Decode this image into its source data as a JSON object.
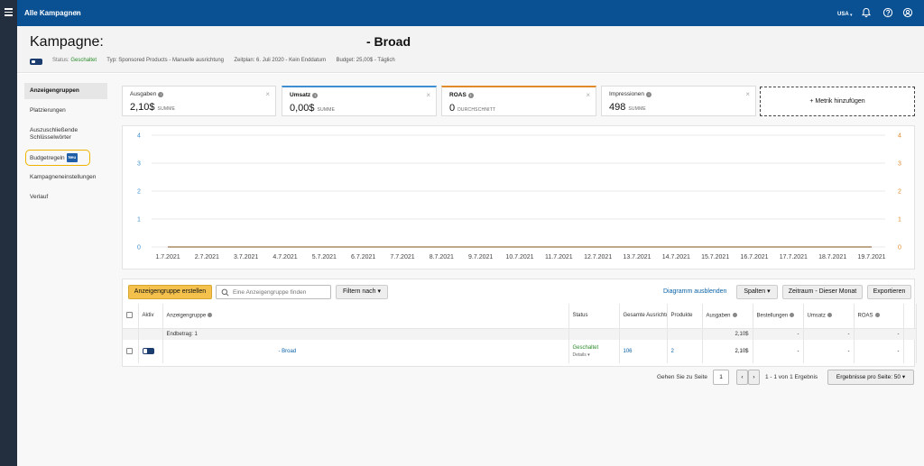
{
  "topbar": {
    "breadcrumb": "Alle Kampagnen",
    "breadcrumb_arrow": ">",
    "locale": "USA",
    "locale_caret": "▾",
    "icons": [
      "bell-icon",
      "help-icon",
      "account-icon"
    ]
  },
  "header": {
    "title": "Kampagne:",
    "title_suffix": "- Broad",
    "status_label": "Status:",
    "status_value": "Geschaltet",
    "type": "Typ: Sponsored Products - Manuelle ausrichtung",
    "period": "Zeitplan: 6. Juli 2020 - Kein Enddatum",
    "budget": "Budget: 25,00$ - Täglich"
  },
  "sidebar": {
    "items": [
      {
        "label": "Anzeigengruppen"
      },
      {
        "label": "Platzierungen"
      },
      {
        "label": "Auszuschließende Schlüsselwörter"
      },
      {
        "label": "Budgetregeln",
        "badge": "Neu"
      },
      {
        "label": "Kampagneneinstellungen"
      },
      {
        "label": "Verlauf"
      }
    ]
  },
  "metrics": [
    {
      "label": "Ausgaben",
      "value": "2,10$",
      "unit": "SUMME",
      "close": "×",
      "accent": ""
    },
    {
      "label": "Umsatz",
      "value": "0,00$",
      "unit": "SUMME",
      "close": "×",
      "accent": "#3e8fd1"
    },
    {
      "label": "ROAS",
      "value": "0",
      "unit": "DURCHSCHNITT",
      "close": "×",
      "accent": "#e08a2b"
    },
    {
      "label": "Impressionen",
      "value": "498",
      "unit": "SUMME",
      "close": "×",
      "accent": ""
    }
  ],
  "add_metric": "+ Metrik hinzufügen",
  "chart_data": {
    "type": "line",
    "x": [
      "1.7.2021",
      "2.7.2021",
      "3.7.2021",
      "4.7.2021",
      "5.7.2021",
      "6.7.2021",
      "7.7.2021",
      "8.7.2021",
      "9.7.2021",
      "10.7.2021",
      "11.7.2021",
      "12.7.2021",
      "13.7.2021",
      "14.7.2021",
      "15.7.2021",
      "16.7.2021",
      "17.7.2021",
      "18.7.2021",
      "19.7.2021"
    ],
    "series": [
      {
        "values": [
          0,
          0,
          0,
          0,
          0,
          0,
          0,
          0,
          0,
          0,
          0,
          0,
          0,
          0,
          0,
          0,
          0,
          0,
          0
        ],
        "color": "#3e8fd1"
      },
      {
        "values": [
          0,
          0,
          0,
          0,
          0,
          0,
          0,
          0,
          0,
          0,
          0,
          0,
          0,
          0,
          0,
          0,
          0,
          0,
          0
        ],
        "color": "#e08a2b"
      }
    ],
    "ylim": [
      0,
      4
    ],
    "yticks_left": [
      "0",
      "1",
      "2",
      "3",
      "4"
    ],
    "yticks_right": [
      "0",
      "1",
      "2",
      "3",
      "4"
    ],
    "left_tick_color": "#3e8fd1",
    "right_tick_color": "#e08a2b",
    "grid": true
  },
  "toolbar": {
    "create_label": "Anzeigengruppe erstellen",
    "search_placeholder": "Eine Anzeigengruppe finden",
    "filter_label": "Filtern nach",
    "hide_chart_label": "Diagramm ausblenden",
    "columns_label": "Spalten",
    "range_label": "Zeitraum - Dieser Monat",
    "export_label": "Exportieren",
    "caret": "▾"
  },
  "table": {
    "headers": [
      "Aktiv",
      "Anzeigengruppe",
      "Status",
      "Gesamte Ausrichtung",
      "Produkte",
      "Ausgaben",
      "Bestellungen",
      "Umsatz",
      "ROAS"
    ],
    "total_label": "Endbetrag: 1",
    "total_values": {
      "ausgaben": "2,10$",
      "bestellungen": "-",
      "umsatz": "-",
      "roas": "-"
    },
    "rows": [
      {
        "name": "- Broad",
        "status": "Geschaltet",
        "status_sub": "Details ▾",
        "targeting": "106",
        "products": "2",
        "ausgaben": "2,10$",
        "bestellungen": "-",
        "umsatz": "-",
        "roas": "-"
      }
    ]
  },
  "pager": {
    "goto_label": "Gehen Sie zu Seite",
    "page": "1",
    "prev": "‹",
    "next": "›",
    "result_text": "1 - 1 von 1 Ergebnis",
    "per_page_label": "Ergebnisse pro Seite: 50",
    "caret": "▾"
  }
}
